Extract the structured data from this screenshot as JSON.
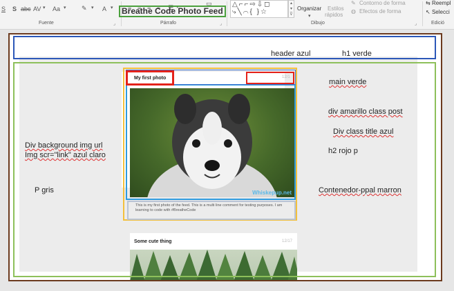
{
  "ribbon": {
    "font_group": "Fuente",
    "paragraph_group": "Párrafo",
    "drawing_group": "Dibujo",
    "editing_group": "Edició",
    "font_controls": [
      "S",
      "abc",
      "AV",
      "Aa",
      "A"
    ],
    "arrange_label": "Organizar",
    "styles_label": "Estilos",
    "quick_label": "rápidos",
    "shape_outline": "Contorno de forma",
    "shape_effects": "Efectos de forma",
    "replace_label": "Reempl",
    "select_label": "Selecci"
  },
  "slide": {
    "title": "Breathe Code Photo Feed",
    "notes": {
      "header": "header azul",
      "h1": "h1 verde",
      "main": "main verde",
      "div_post": "div amarillo class post",
      "div_title": "Div class title azul",
      "h2": "h2 rojo p",
      "div_bg_1": "Div background img url",
      "div_bg_2": "Img scr=\"link\" azul claro",
      "p": "P gris",
      "container": "Contenedor-ppal marron"
    },
    "post1": {
      "title": "My first photo",
      "date": "12/1",
      "caption": "This is my first photo of the feed. This is a multi line comment for testing purposes. I am learning to code with #BreatheCode",
      "watermark": "Whiskepup.net"
    },
    "post2": {
      "title": "Some cute thing",
      "date": "12/17"
    }
  },
  "colors": {
    "brown": "#6b3a1e",
    "blue": "#2b57b8",
    "green": "#8dc05a",
    "yellow": "#f3c03c",
    "light_blue": "#2e9bde",
    "red": "#e4221a",
    "grey": "#b9c4d6"
  }
}
